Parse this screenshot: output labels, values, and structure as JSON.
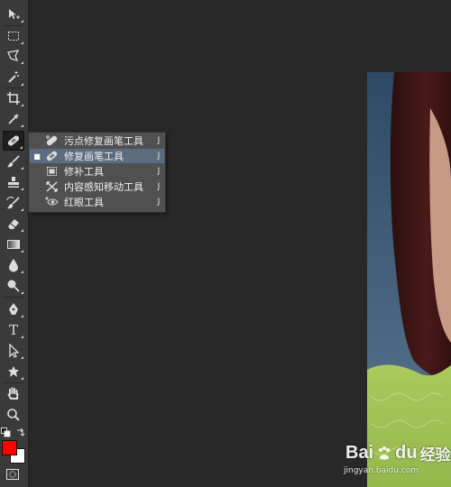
{
  "toolbar": {
    "tools": [
      {
        "name": "move-tool",
        "icon": "move-icon"
      },
      {
        "name": "marquee-tool",
        "icon": "rect-marquee-icon"
      },
      {
        "name": "lasso-tool",
        "icon": "polygon-lasso-icon"
      },
      {
        "name": "magic-wand-tool",
        "icon": "magic-wand-icon"
      },
      {
        "name": "crop-tool",
        "icon": "crop-icon"
      },
      {
        "name": "eyedropper-tool",
        "icon": "eyedropper-icon"
      },
      {
        "name": "healing-brush-tool",
        "icon": "bandage-icon",
        "active": true
      },
      {
        "name": "brush-tool",
        "icon": "brush-icon"
      },
      {
        "name": "clone-stamp-tool",
        "icon": "stamp-icon"
      },
      {
        "name": "history-brush-tool",
        "icon": "history-brush-icon"
      },
      {
        "name": "eraser-tool",
        "icon": "eraser-icon"
      },
      {
        "name": "gradient-tool",
        "icon": "gradient-icon"
      },
      {
        "name": "blur-tool",
        "icon": "drop-icon"
      },
      {
        "name": "dodge-tool",
        "icon": "dodge-icon"
      },
      {
        "name": "pen-tool",
        "icon": "pen-icon"
      },
      {
        "name": "type-tool",
        "icon": "type-icon",
        "glyph": "T"
      },
      {
        "name": "path-select-tool",
        "icon": "arrow-select-icon"
      },
      {
        "name": "shape-tool",
        "icon": "custom-shape-icon"
      },
      {
        "name": "hand-tool",
        "icon": "hand-icon"
      },
      {
        "name": "zoom-tool",
        "icon": "zoom-icon"
      }
    ],
    "foreground_color": "#ff0000",
    "background_color": "#ffffff"
  },
  "flyout": {
    "items": [
      {
        "label": "污点修复画笔工具",
        "shortcut": "J",
        "icon": "spot-healing-icon",
        "selected": false
      },
      {
        "label": "修复画笔工具",
        "shortcut": "J",
        "icon": "healing-brush-icon",
        "selected": true,
        "check": "■"
      },
      {
        "label": "修补工具",
        "shortcut": "J",
        "icon": "patch-icon",
        "selected": false
      },
      {
        "label": "内容感知移动工具",
        "shortcut": "J",
        "icon": "content-aware-move-icon",
        "selected": false
      },
      {
        "label": "红眼工具",
        "shortcut": "J",
        "icon": "red-eye-icon",
        "selected": false
      }
    ]
  },
  "watermark": {
    "logo_text_1": "Bai",
    "logo_text_2": "du",
    "logo_text_3": "经验",
    "url": "jingyan.baidu.com"
  }
}
